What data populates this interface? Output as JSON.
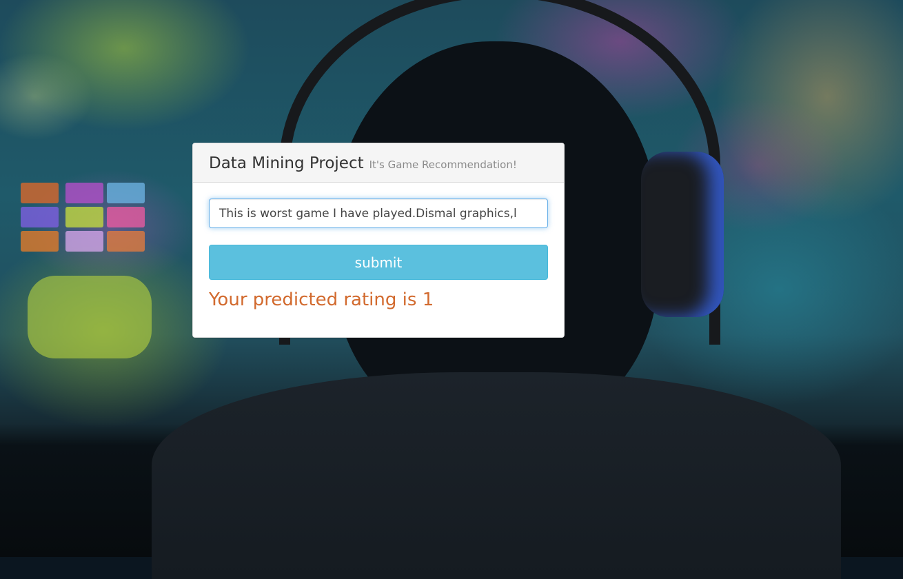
{
  "panel": {
    "title": "Data Mining Project",
    "subtitle": "It's Game Recommendation!"
  },
  "review_input": {
    "value": "This is worst game I have played.Dismal graphics,l"
  },
  "submit": {
    "label": "submit"
  },
  "result": {
    "text": "Your predicted rating is 1"
  },
  "colors": {
    "button": "#5bc0de",
    "result_text": "#d26a2e",
    "heading_bg": "#f5f5f5"
  }
}
